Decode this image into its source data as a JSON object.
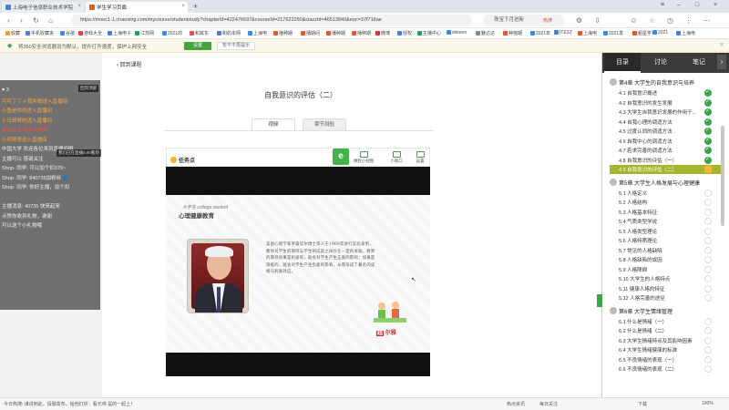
{
  "browser": {
    "tabs": [
      {
        "title": "上海电子信息职业技术学院",
        "active": false
      },
      {
        "title": "学生学习页面",
        "active": true
      }
    ],
    "new_tab": "+",
    "url": "https://mooc1-1.chaoxing.com/mycourse/studentstudy?chapterId=422476697&courseId=217622260&clazzId=46513840&enc=37f718ae",
    "search_placeholder": "珠宝下月进新",
    "hot_label": "热搜",
    "bookmarks": [
      "收藏",
      "手机收藏夹",
      "谷歌",
      "游戏大全",
      "上海电子",
      "江苏网",
      "2021的",
      "和其东",
      "和的本网",
      "上海电",
      "播种期",
      "播期间",
      "播种期",
      "播种期",
      "微博",
      "授权",
      "主播中心",
      "shinem",
      "魅达达",
      "种植期",
      "2021年",
      "ITEST",
      "上海电",
      "2021发",
      "超星学",
      "2021",
      "上海电"
    ]
  },
  "notice": {
    "text": "将360安全浏览器设为默认，提升打开速度，保护上网安全",
    "confirm": "设置",
    "dismiss": "暂不不再提示"
  },
  "course": {
    "back_label": "回到课程",
    "lesson_title": "自我意识的评估（二）",
    "tabs": [
      "视频",
      "章节测验"
    ],
    "task_label": "任务点",
    "tools": [
      "课程小视频",
      "小窗口",
      "设置"
    ],
    "slide": {
      "brand_small": "大学生 college student",
      "brand_title": "心理健康教育",
      "text": "美国心理学家罗森塔尔博士等人于1968年进行实验表明，教师对学生的期待与学生的成就之间存在一定的关联。教师的期待如果是积极的，就会对学生产生正面的影响；如果是消极的，就会对学生产生负面的影响，从而形成了著名的皮格马利翁效应。",
      "logo": "尔雅"
    }
  },
  "live_overlay": {
    "lines": [
      {
        "text": "♥ 3",
        "cls": ""
      },
      {
        "text": "可可丁丁 # 我听歌进入直播间",
        "cls": "ov-hl"
      },
      {
        "text": "小鱼是你的进入直播间",
        "cls": "ov-hl"
      },
      {
        "text": "小马哥哥的进入直播间",
        "cls": "ov-hl"
      },
      {
        "text": "最好在此 送礼物刷屏",
        "cls": "ov-red"
      },
      {
        "text": "小明哥哥进入直播间",
        "cls": "ov-hl"
      },
      {
        "text": "中国大学 欢迎各位来到直播间哦",
        "cls": ""
      },
      {
        "text": "主播可以 感谢关注",
        "cls": ""
      },
      {
        "text": "Shop· 同学: 可以加个扣379~",
        "cls": ""
      },
      {
        "text": "Shop· 同学: 840735加粉丝 👤",
        "cls": ""
      },
      {
        "text": "Shop· 同学: 你好主播，加个扣",
        "cls": ""
      },
      {
        "text": "",
        "cls": ""
      },
      {
        "text": "主播消息: 40735 快来起来",
        "cls": ""
      },
      {
        "text": "点赞你收到礼物，谢谢",
        "cls": ""
      },
      {
        "text": "可以送个小礼物哦",
        "cls": ""
      }
    ],
    "tip1": "回到顶部",
    "tip2": "我们已在直播0.00看到"
  },
  "sidebar": {
    "tabs": [
      "目录",
      "讨论",
      "笔记"
    ],
    "chapters": [
      {
        "title": "第4章 大学生的自我意识与培养",
        "sections": [
          {
            "title": "4.1 自我意识概述",
            "status": "done"
          },
          {
            "title": "4.2 自我意识的发生发展",
            "status": "done"
          },
          {
            "title": "4.3 大学生自我意识发展的作用于...",
            "status": "done"
          },
          {
            "title": "4.4 自我心理的调适方法",
            "status": "done"
          },
          {
            "title": "4.5 过度认同的调适方法",
            "status": "done"
          },
          {
            "title": "4.6 自我中心的调适方法",
            "status": "done"
          },
          {
            "title": "4.7 若求完善的调适方法",
            "status": "done"
          },
          {
            "title": "4.8 自我意识的评估（一）",
            "status": "done"
          },
          {
            "title": "4.9 自我意识的评估（二）",
            "status": "current"
          }
        ]
      },
      {
        "title": "第5章 大学生人格发展与心理健康",
        "sections": [
          {
            "title": "5.1 人格定义",
            "status": "todo"
          },
          {
            "title": "5.2 人格结构",
            "status": "todo"
          },
          {
            "title": "5.3 人格基本特征",
            "status": "todo"
          },
          {
            "title": "5.4 气质类型学说",
            "status": "todo"
          },
          {
            "title": "5.5 人格类型理论",
            "status": "todo"
          },
          {
            "title": "5.6 人格特质理论",
            "status": "todo"
          },
          {
            "title": "5.7 常见的人格缺陷",
            "status": "todo"
          },
          {
            "title": "5.8 人格缺陷的成因",
            "status": "todo"
          },
          {
            "title": "5.9 人格障碍",
            "status": "todo"
          },
          {
            "title": "5.10 大学生的人格特点",
            "status": "todo"
          },
          {
            "title": "5.11 健康人格的特征",
            "status": "todo"
          },
          {
            "title": "5.12 人格完善的途径",
            "status": "todo"
          }
        ]
      },
      {
        "title": "第6章 大学生情绪管理",
        "sections": [
          {
            "title": "6.1 什么是情绪（一）",
            "status": "todo"
          },
          {
            "title": "6.2 什么是情绪（二）",
            "status": "todo"
          },
          {
            "title": "6.3 大学生情绪特点及其影响因素",
            "status": "todo"
          },
          {
            "title": "6.4 大学生情绪健康的标准",
            "status": "todo"
          },
          {
            "title": "6.5 不良情绪的表现（一）",
            "status": "todo"
          },
          {
            "title": "6.6 不良情绪的表现（二）",
            "status": "todo"
          }
        ]
      }
    ]
  },
  "statusbar": {
    "left": "今日热搜: 谁说到此，投融发布，给他打折：看元帅 是的一起上！",
    "items": [
      "热点资讯",
      "每日关注",
      "下载",
      "100%"
    ]
  },
  "colors": {
    "accent_green": "#45a340",
    "done_green": "#3aa54a",
    "current_bg": "#a7b52e",
    "panel_dark": "#3a3a3a"
  }
}
